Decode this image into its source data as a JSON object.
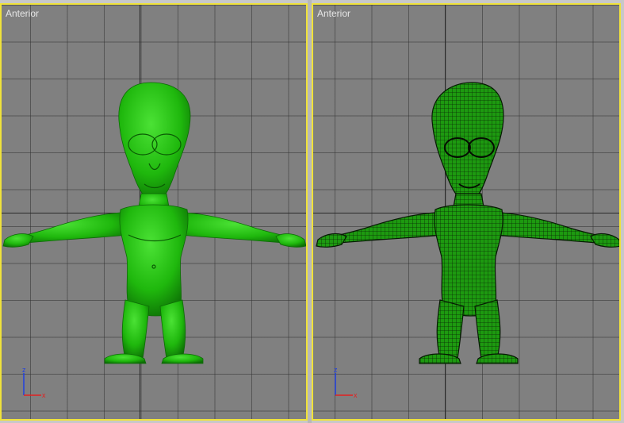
{
  "viewports": [
    {
      "label": "Anterior",
      "mode": "smooth-shaded",
      "active": true
    },
    {
      "label": "Anterior",
      "mode": "wireframe-shaded",
      "active": true
    }
  ],
  "gizmo": {
    "up_axis": "z",
    "right_axis": "x"
  },
  "colors": {
    "viewport_bg": "#808080",
    "grid": "#404040",
    "active_border": "#f0e23a",
    "model_green": "#22c40f",
    "wire": "#0a2a05",
    "axis_x": "#e22020",
    "axis_z": "#2040e0"
  }
}
